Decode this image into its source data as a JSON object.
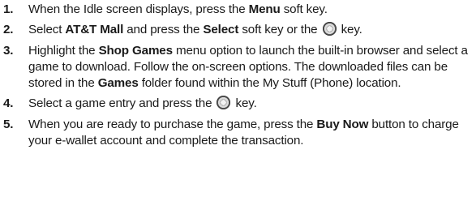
{
  "steps": [
    {
      "number": "1.",
      "segments": [
        {
          "text": "When the Idle screen displays, press the ",
          "bold": false
        },
        {
          "text": "Menu",
          "bold": true
        },
        {
          "text": " soft key.",
          "bold": false
        }
      ]
    },
    {
      "number": "2.",
      "segments": [
        {
          "text": "Select ",
          "bold": false
        },
        {
          "text": "AT&T Mall",
          "bold": true
        },
        {
          "text": " and press the ",
          "bold": false
        },
        {
          "text": "Select",
          "bold": true
        },
        {
          "text": " soft key or the ",
          "bold": false
        },
        {
          "icon": "center-select-key-icon"
        },
        {
          "text": " key.",
          "bold": false
        }
      ]
    },
    {
      "number": "3.",
      "segments": [
        {
          "text": "Highlight the ",
          "bold": false
        },
        {
          "text": "Shop Games",
          "bold": true
        },
        {
          "text": " menu option to launch the built-in browser and select a game to download. Follow the on-screen options. The downloaded files can be stored in the ",
          "bold": false
        },
        {
          "text": "Games",
          "bold": true
        },
        {
          "text": " folder found within the My Stuff (Phone) location.",
          "bold": false
        }
      ]
    },
    {
      "number": "4.",
      "segments": [
        {
          "text": "Select a game entry and press the ",
          "bold": false
        },
        {
          "icon": "center-select-key-icon"
        },
        {
          "text": " key.",
          "bold": false
        }
      ]
    },
    {
      "number": "5.",
      "segments": [
        {
          "text": "When you are ready to purchase the game, press the ",
          "bold": false
        },
        {
          "text": "Buy Now",
          "bold": true
        },
        {
          "text": " button to charge your e-wallet account and complete the transaction.",
          "bold": false
        }
      ]
    }
  ]
}
